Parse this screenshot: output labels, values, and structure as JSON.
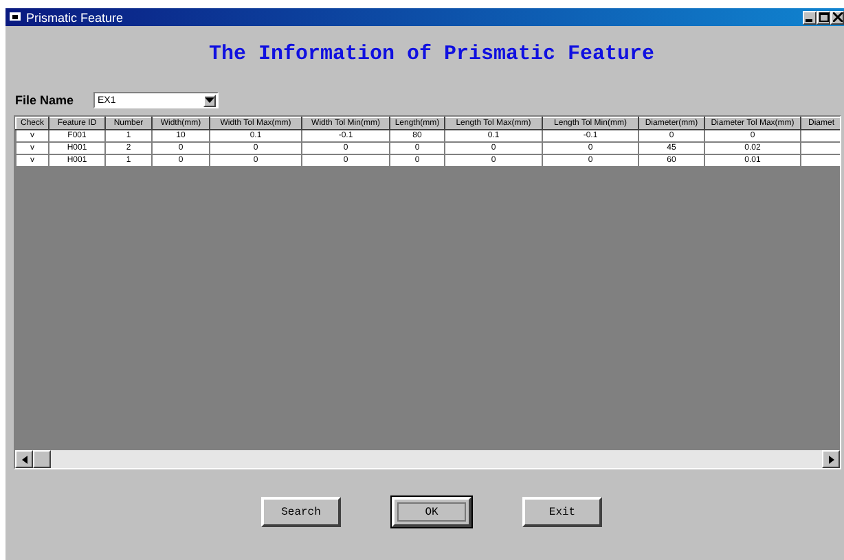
{
  "window": {
    "title": "Prismatic Feature"
  },
  "heading": "The Information of Prismatic Feature",
  "file_name": {
    "label": "File Name",
    "value": "EX1"
  },
  "table": {
    "columns": [
      "Check",
      "Feature ID",
      "Number",
      "Width(mm)",
      "Width Tol Max(mm)",
      "Width Tol Min(mm)",
      "Length(mm)",
      "Length Tol Max(mm)",
      "Length Tol Min(mm)",
      "Diameter(mm)",
      "Diameter Tol Max(mm)",
      "Diamet"
    ],
    "rows": [
      [
        "v",
        "F001",
        "1",
        "10",
        "0.1",
        "-0.1",
        "80",
        "0.1",
        "-0.1",
        "0",
        "0",
        ""
      ],
      [
        "v",
        "H001",
        "2",
        "0",
        "0",
        "0",
        "0",
        "0",
        "0",
        "45",
        "0.02",
        ""
      ],
      [
        "v",
        "H001",
        "1",
        "0",
        "0",
        "0",
        "0",
        "0",
        "0",
        "60",
        "0.01",
        ""
      ]
    ]
  },
  "buttons": [
    {
      "label": "Search",
      "default": false
    },
    {
      "label": "OK",
      "default": true
    },
    {
      "label": "Exit",
      "default": false
    }
  ]
}
